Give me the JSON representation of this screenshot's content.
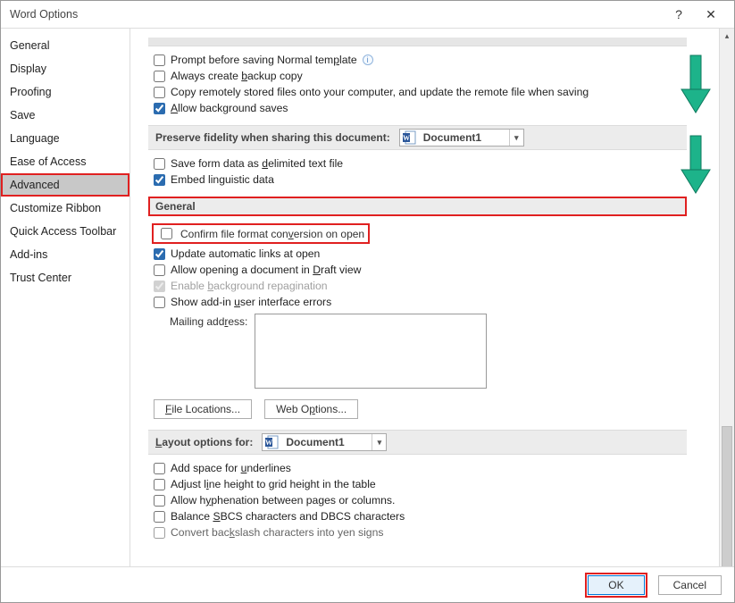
{
  "title": "Word Options",
  "sidebar": {
    "items": [
      {
        "label": "General"
      },
      {
        "label": "Display"
      },
      {
        "label": "Proofing"
      },
      {
        "label": "Save"
      },
      {
        "label": "Language"
      },
      {
        "label": "Ease of Access"
      },
      {
        "label": "Advanced"
      },
      {
        "label": "Customize Ribbon"
      },
      {
        "label": "Quick Access Toolbar"
      },
      {
        "label": "Add-ins"
      },
      {
        "label": "Trust Center"
      }
    ],
    "selected_index": 6
  },
  "save_section": {
    "prompt_before_normal": "Prompt before saving Normal template",
    "always_backup": "Always create backup copy",
    "copy_remote": "Copy remotely stored files onto your computer, and update the remote file when saving",
    "allow_bg_saves": "Allow background saves"
  },
  "fidelity_section": {
    "title": "Preserve fidelity when sharing this document:",
    "doc": "Document1",
    "save_form_data": "Save form data as delimited text file",
    "embed_linguistic": "Embed linguistic data"
  },
  "general_section": {
    "title": "General",
    "confirm_conversion": "Confirm file format conversion on open",
    "update_links": "Update automatic links at open",
    "allow_draft": "Allow opening a document in Draft view",
    "enable_bg_repag": "Enable background repagination",
    "show_addin_errors": "Show add-in user interface errors",
    "mailing_label": "Mailing address:",
    "file_locations_btn": "File Locations...",
    "web_options_btn": "Web Options..."
  },
  "layout_section": {
    "title": "Layout options for:",
    "doc": "Document1",
    "add_space_underlines": "Add space for underlines",
    "adjust_line_height": "Adjust line height to grid height in the table",
    "allow_hyphenation": "Allow hyphenation between pages or columns.",
    "balance_sbcs": "Balance SBCS characters and DBCS characters",
    "convert_backslash": "Convert backslash characters into yen signs"
  },
  "footer": {
    "ok": "OK",
    "cancel": "Cancel"
  }
}
